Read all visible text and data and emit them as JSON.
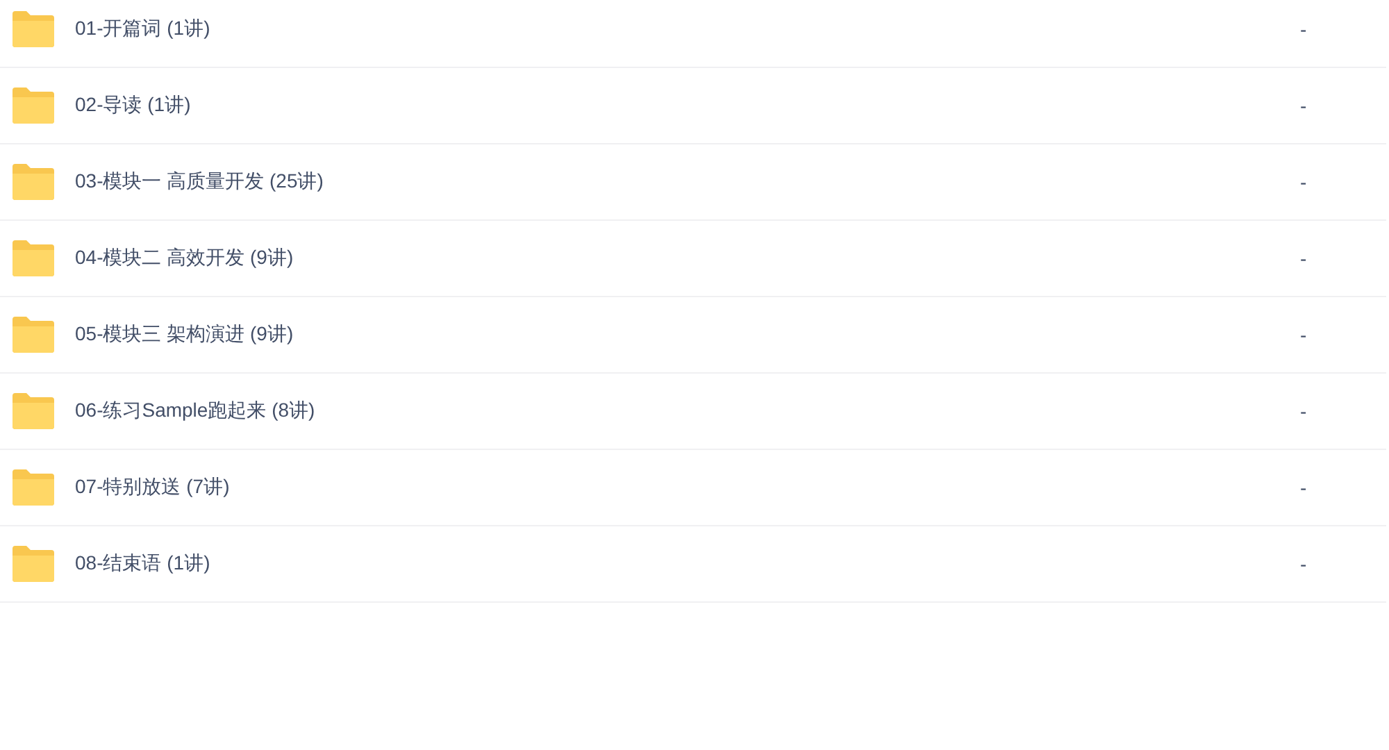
{
  "files": [
    {
      "name": "01-开篇词 (1讲)",
      "size": "-"
    },
    {
      "name": "02-导读 (1讲)",
      "size": "-"
    },
    {
      "name": "03-模块一 高质量开发 (25讲)",
      "size": "-"
    },
    {
      "name": "04-模块二 高效开发 (9讲)",
      "size": "-"
    },
    {
      "name": "05-模块三 架构演进 (9讲)",
      "size": "-"
    },
    {
      "name": "06-练习Sample跑起来 (8讲)",
      "size": "-"
    },
    {
      "name": "07-特别放送 (7讲)",
      "size": "-"
    },
    {
      "name": "08-结束语 (1讲)",
      "size": "-"
    }
  ]
}
